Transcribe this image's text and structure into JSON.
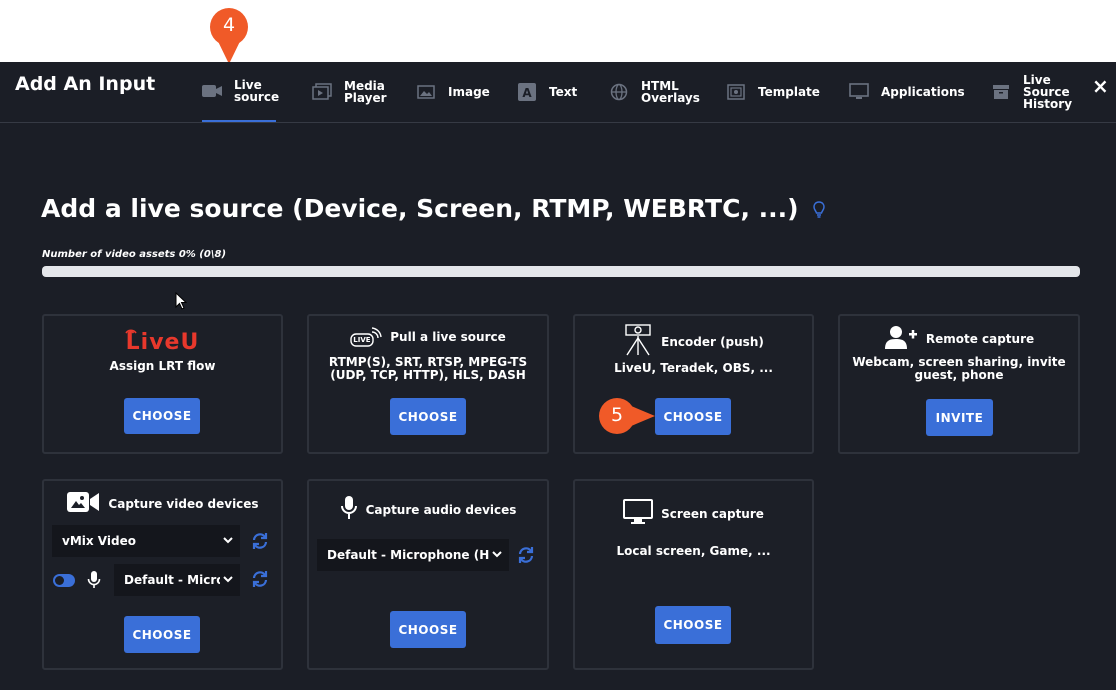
{
  "header": {
    "title": "Add An Input",
    "close_icon": "×"
  },
  "tabs": [
    {
      "label": "Live\nsource",
      "icon": "camera-icon",
      "active": true
    },
    {
      "label": "Media\nPlayer",
      "icon": "media-player-icon"
    },
    {
      "label": "Image",
      "icon": "image-icon"
    },
    {
      "label": "Text",
      "icon": "text-icon"
    },
    {
      "label": "HTML\nOverlays",
      "icon": "globe-icon"
    },
    {
      "label": "Template",
      "icon": "template-icon"
    },
    {
      "label": "Applications",
      "icon": "monitor-icon"
    },
    {
      "label": "Live\nSource\nHistory",
      "icon": "archive-icon"
    }
  ],
  "main": {
    "heading": "Add a live source (Device, Screen, RTMP, WEBRTC, ...)",
    "assets_label": "Number of video assets 0% (0\\8)",
    "assets_progress": 0
  },
  "cards": {
    "liveu": {
      "logo": "LiveU",
      "title": "Assign LRT flow",
      "button": "CHOOSE"
    },
    "pull": {
      "title": "Pull a live source",
      "subtitle": "RTMP(S), SRT, RTSP, MPEG-TS (UDP, TCP, HTTP), HLS, DASH",
      "icon_text": "LIVE",
      "button": "CHOOSE"
    },
    "encoder": {
      "title": "Encoder (push)",
      "subtitle": "LiveU, Teradek, OBS, ...",
      "button": "CHOOSE"
    },
    "remote": {
      "title": "Remote capture",
      "subtitle": "Webcam, screen sharing, invite guest, phone",
      "button": "INVITE"
    },
    "video": {
      "title": "Capture video devices",
      "video_select": "vMix Video",
      "audio_select": "Default - Microphone",
      "audio_enabled": true,
      "button": "CHOOSE"
    },
    "audio": {
      "title": "Capture audio devices",
      "select": "Default - Microphone (HD",
      "button": "CHOOSE"
    },
    "screen": {
      "title": "Screen capture",
      "subtitle": "Local screen, Game, ...",
      "button": "CHOOSE"
    }
  },
  "callouts": {
    "step4": "4",
    "step5": "5"
  },
  "colors": {
    "accent": "#3a6fd8",
    "background": "#1b1e26",
    "card": "#1c1f27",
    "callout": "#f05a28",
    "liveu_red": "#e8382c"
  }
}
